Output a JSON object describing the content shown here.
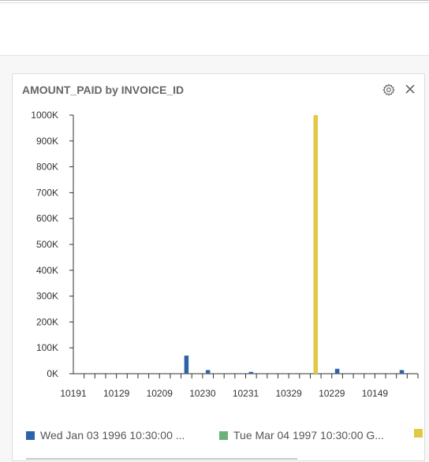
{
  "widget": {
    "title": "AMOUNT_PAID by INVOICE_ID",
    "settings_icon": "gear-icon",
    "close_icon": "close-icon"
  },
  "legend": [
    {
      "label": "Wed Jan 03 1996 10:30:00 ...",
      "color": "#2e62a8"
    },
    {
      "label": "Tue Mar 04 1997 10:30:00 G...",
      "color": "#6ab27a"
    },
    {
      "label": "",
      "color": "#e2c843"
    }
  ],
  "chart_data": {
    "type": "bar",
    "title": "AMOUNT_PAID by INVOICE_ID",
    "xlabel": "",
    "ylabel": "",
    "ylim": [
      0,
      1000000
    ],
    "yticks": [
      0,
      100000,
      200000,
      300000,
      400000,
      500000,
      600000,
      700000,
      800000,
      900000,
      1000000
    ],
    "ytick_labels": [
      "0K",
      "100K",
      "200K",
      "300K",
      "400K",
      "500K",
      "600K",
      "700K",
      "800K",
      "900K",
      "1000K"
    ],
    "xtick_labels": [
      "10191",
      "10129",
      "10209",
      "10230",
      "10231",
      "10329",
      "10229",
      "10149"
    ],
    "grid": false,
    "legend_position": "bottom",
    "bars": [
      {
        "slot": 10.5,
        "color": "#2e62a8",
        "value": 70000
      },
      {
        "slot": 12.5,
        "color": "#2e62a8",
        "value": 14000
      },
      {
        "slot": 16.5,
        "color": "#2e62a8",
        "value": 7000
      },
      {
        "slot": 18.5,
        "color": "#2e62a8",
        "value": 2000
      },
      {
        "slot": 22.5,
        "color": "#e2c843",
        "value": 1000000
      },
      {
        "slot": 24.5,
        "color": "#2e62a8",
        "value": 19000
      },
      {
        "slot": 30.5,
        "color": "#2e62a8",
        "value": 14000
      }
    ]
  }
}
